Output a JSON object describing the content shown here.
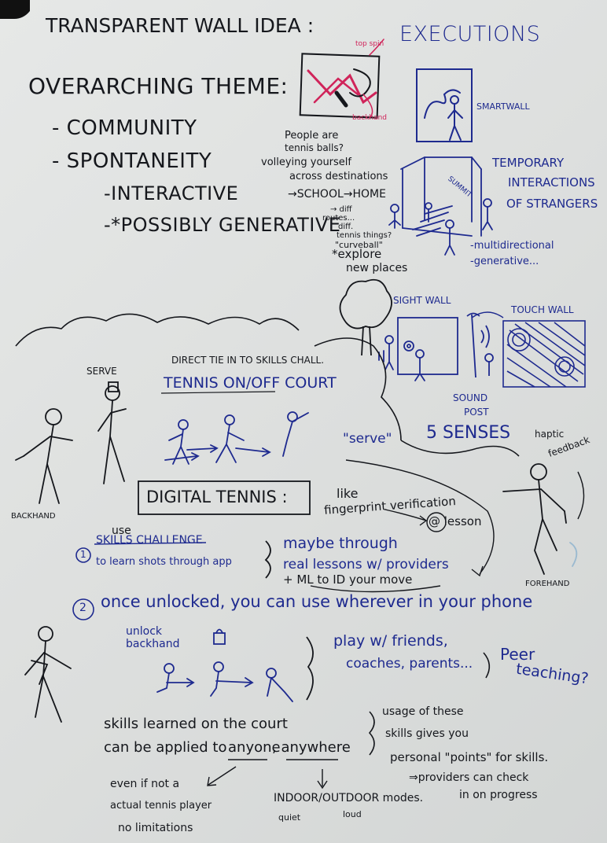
{
  "title": "TRANSPARENT WALL IDEA :",
  "executions": "EXECUTIONS",
  "theme": {
    "heading": "OVERARCHING THEME:",
    "items": [
      "- COMMUNITY",
      "- SPONTANEITY",
      "-INTERACTIVE",
      "-*POSSIBLY GENERATIVE"
    ]
  },
  "sketch_labels": {
    "backhand_pink": "backhand",
    "tip_pink": "top spin",
    "smartwall": "SMARTWALL",
    "summit": "SUMMIT"
  },
  "ideas": {
    "people_are": "People are",
    "tennis_balls": "tennis balls?",
    "volleying": "volleying yourself",
    "across": "across destinations",
    "school_home": "→SCHOOL→HOME",
    "diff_routes": "→ diff",
    "routes": "routes...",
    "diff2": "diff.",
    "tennis_things": "tennis things?",
    "curveball": "\"curveball\"",
    "explore": "*explore",
    "new_places": "new places"
  },
  "temporary": [
    "TEMPORARY",
    "INTERACTIONS",
    "OF STRANGERS"
  ],
  "multidirectional": "-multidirectional",
  "generative": "-generative...",
  "sight_wall": "SIGHT WALL",
  "touch_wall": "TOUCH WALL",
  "sound_post": [
    "SOUND",
    "POST"
  ],
  "five_senses": "5 SENSES",
  "haptic": [
    "haptic",
    "feedback"
  ],
  "direct_tie": "DIRECT TIE IN TO SKILLS CHALL.",
  "tennis_on_off": "TENNIS ON/OFF COURT",
  "serve_label": "SERVE",
  "serve_quote": "\"serve\"",
  "backhand_label": "BACKHAND",
  "forehand_label": "FOREHAND",
  "digital_tennis": "DIGITAL TENNIS :",
  "fingerprint": [
    "like",
    "fingerprint verification",
    "@ lesson"
  ],
  "step1": {
    "num": "1",
    "use": "use",
    "line1": "SKILLS CHALLENGE",
    "line2": "to learn shots through app"
  },
  "maybe": [
    "maybe through",
    "real lessons w/ providers",
    "+ ML to ID your move"
  ],
  "step2": {
    "num": "2",
    "text": "once unlocked, you can use wherever in your phone"
  },
  "unlock": [
    "unlock",
    "backhand"
  ],
  "play": [
    "play w/ friends,",
    "coaches, parents...",
    "Peer",
    "teaching?"
  ],
  "skills": [
    "skills learned on the court",
    "can be applied to",
    "anyone",
    ", anywhere"
  ],
  "usage": [
    "usage of these",
    "skills gives you",
    "personal \"points\" for skills.",
    "⇒providers can check",
    "in on progress"
  ],
  "even": [
    "even if not a",
    "actual tennis player",
    "no limitations"
  ],
  "modes": [
    "INDOOR/OUTDOOR modes.",
    "quiet",
    "loud"
  ]
}
